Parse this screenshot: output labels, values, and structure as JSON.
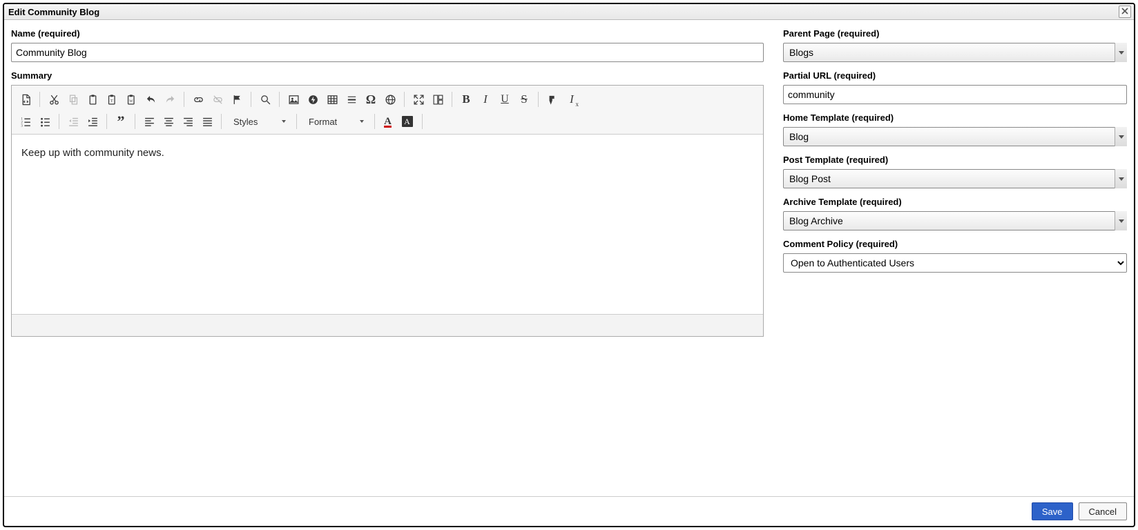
{
  "dialog": {
    "title": "Edit Community Blog"
  },
  "left": {
    "name_label": "Name (required)",
    "name_value": "Community Blog",
    "summary_label": "Summary",
    "summary_body": "Keep up with community news.",
    "styles_label": "Styles",
    "format_label": "Format"
  },
  "right": {
    "parent_page_label": "Parent Page (required)",
    "parent_page_value": "Blogs",
    "partial_url_label": "Partial URL (required)",
    "partial_url_value": "community",
    "home_template_label": "Home Template (required)",
    "home_template_value": "Blog",
    "post_template_label": "Post Template (required)",
    "post_template_value": "Blog Post",
    "archive_template_label": "Archive Template (required)",
    "archive_template_value": "Blog Archive",
    "comment_policy_label": "Comment Policy (required)",
    "comment_policy_value": "Open to Authenticated Users"
  },
  "footer": {
    "save": "Save",
    "cancel": "Cancel"
  }
}
